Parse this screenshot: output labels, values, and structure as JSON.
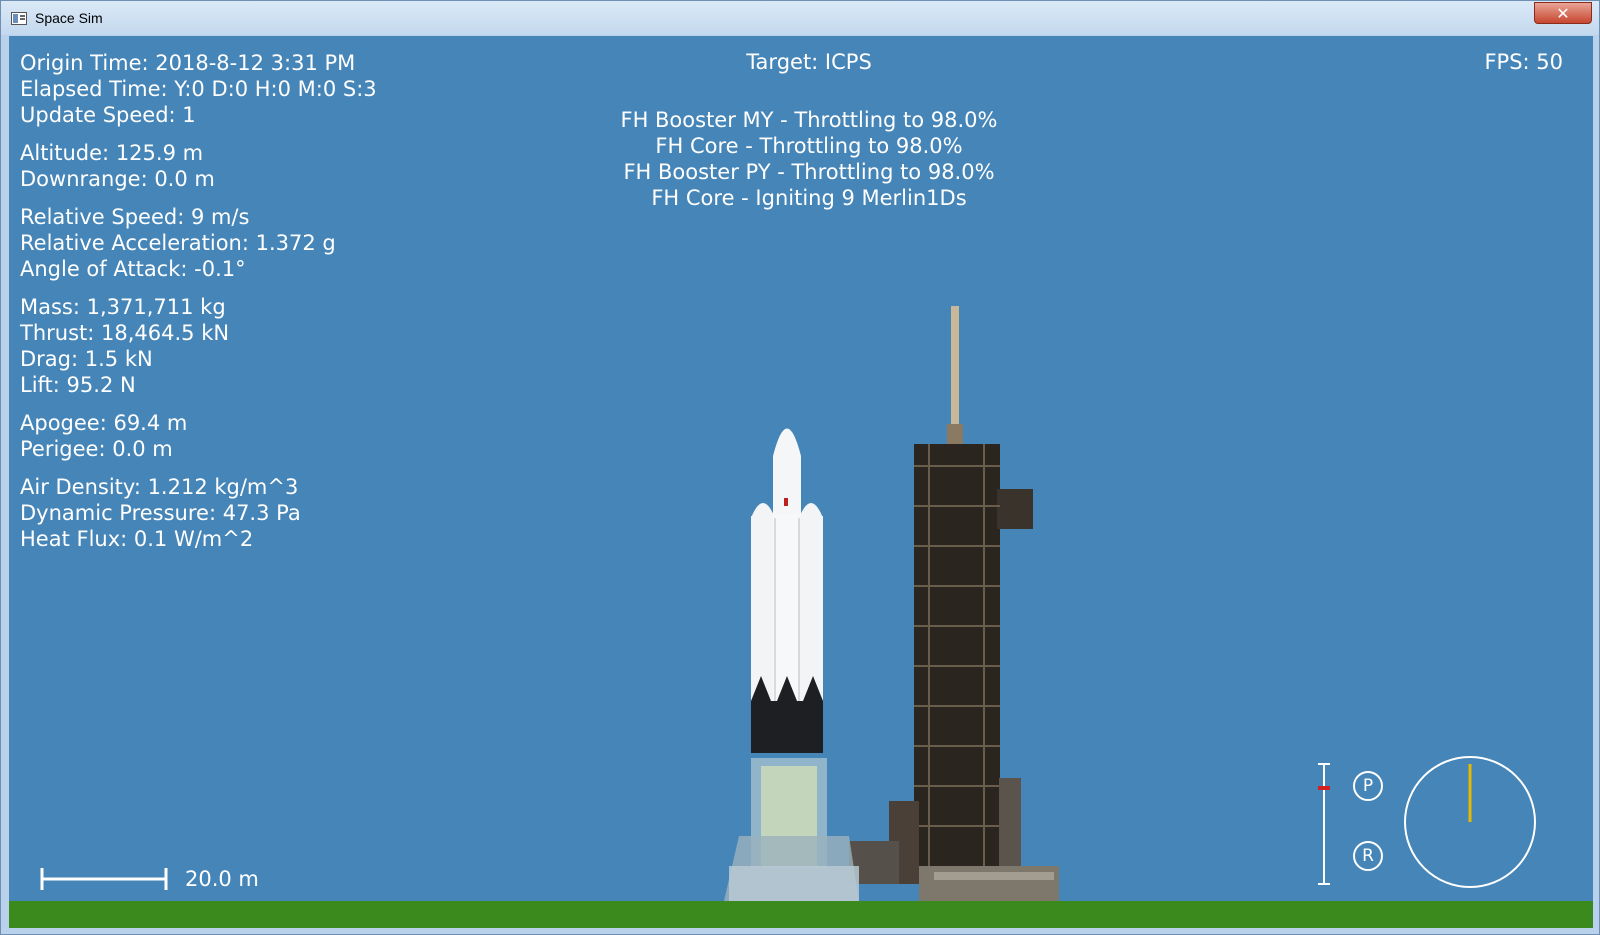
{
  "window": {
    "title": "Space Sim",
    "close_glyph": "✕"
  },
  "hud": {
    "origin_time": "Origin Time: 2018-8-12 3:31 PM",
    "elapsed_time": "Elapsed Time: Y:0 D:0 H:0 M:0 S:3",
    "update_speed": "Update Speed: 1",
    "altitude": "Altitude: 125.9 m",
    "downrange": "Downrange: 0.0 m",
    "relative_speed": "Relative Speed: 9 m/s",
    "relative_acceleration": "Relative Acceleration: 1.372 g",
    "angle_of_attack": "Angle of Attack: -0.1°",
    "mass": "Mass: 1,371,711 kg",
    "thrust": "Thrust: 18,464.5 kN",
    "drag": "Drag: 1.5 kN",
    "lift": "Lift: 95.2 N",
    "apogee": "Apogee: 69.4 m",
    "perigee": "Perigee: 0.0 m",
    "air_density": "Air Density: 1.212 kg/m^3",
    "dynamic_pressure": "Dynamic Pressure: 47.3 Pa",
    "heat_flux": "Heat Flux: 0.1 W/m^2",
    "target": "Target: ICPS",
    "fps": "FPS: 50"
  },
  "events": [
    "FH Booster MY - Throttling to 98.0%",
    "FH Core  - Throttling to 98.0%",
    "FH Booster PY - Throttling to 98.0%",
    "FH Core  - Igniting 9 Merlin1Ds"
  ],
  "scale": {
    "label": "20.0 m"
  },
  "controls": {
    "pitch_label": "P",
    "roll_label": "R",
    "throttle_level": 0.8
  },
  "colors": {
    "sky": "#4685b8",
    "ground": "#3b8a1e",
    "hud_text": "#ffffff",
    "throttle_marker": "#d42020",
    "heading_needle": "#e6b800"
  },
  "icons": {
    "app": "window-app-icon",
    "close": "close-icon"
  }
}
